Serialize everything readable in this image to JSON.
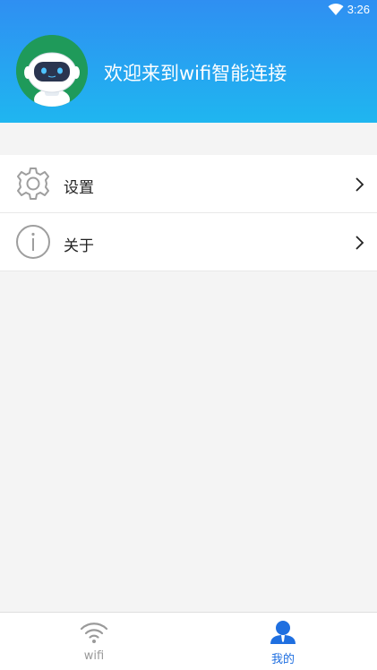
{
  "status_bar": {
    "time": "3:26",
    "icon": "wifi-signal-icon"
  },
  "header": {
    "avatar_icon": "robot-avatar-icon",
    "welcome_text": "欢迎来到wifi智能连接",
    "gradient_top": "#2f8ff2",
    "gradient_bottom": "#1fb6f0"
  },
  "menu": {
    "items": [
      {
        "label": "设置",
        "icon": "gear-icon"
      },
      {
        "label": "关于",
        "icon": "info-icon"
      }
    ]
  },
  "bottom_nav": {
    "tabs": [
      {
        "label": "wifi",
        "icon": "wifi-icon",
        "active": false
      },
      {
        "label": "我的",
        "icon": "user-icon",
        "active": true
      }
    ],
    "active_color": "#1f6fe0",
    "inactive_color": "#999999"
  }
}
